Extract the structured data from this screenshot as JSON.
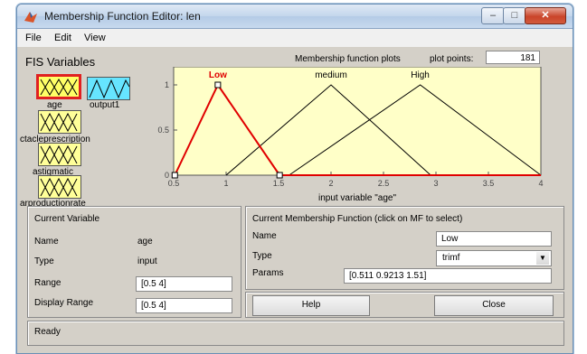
{
  "window": {
    "title": "Membership Function Editor: len",
    "min_icon": "minimize-icon",
    "max_icon": "maximize-icon",
    "close_icon": "close-icon"
  },
  "menu": {
    "items": [
      "File",
      "Edit",
      "View"
    ]
  },
  "fis_variables": {
    "title": "FIS Variables",
    "inputs": [
      "age",
      "ctacleprescription",
      "astigmatic",
      "arproductionrate"
    ],
    "outputs": [
      "output1"
    ],
    "selected": "age"
  },
  "plot": {
    "heading": "Membership function plots",
    "plot_points_label": "plot points:",
    "plot_points_value": "181",
    "xlabel": "input variable \"age\""
  },
  "chart_data": {
    "type": "line",
    "title": "",
    "xlabel": "input variable \"age\"",
    "ylabel": "",
    "xlim": [
      0.5,
      4
    ],
    "ylim": [
      0,
      1
    ],
    "x_ticks": [
      "0.5",
      "1",
      "1.5",
      "2",
      "2.5",
      "3",
      "3.5",
      "4"
    ],
    "y_ticks": [
      "0",
      "0.5",
      "1"
    ],
    "series": [
      {
        "name": "Low",
        "x": [
          0.511,
          0.9213,
          1.51
        ],
        "y": [
          0,
          1,
          0
        ],
        "color": "#e00000",
        "selected": true
      },
      {
        "name": "medium",
        "x": [
          1.0,
          2.0,
          2.95
        ],
        "y": [
          0,
          1,
          0
        ],
        "color": "#000000"
      },
      {
        "name": "High",
        "x": [
          1.6,
          2.85,
          4.0
        ],
        "y": [
          0,
          1,
          0
        ],
        "color": "#000000"
      }
    ]
  },
  "current_variable": {
    "title": "Current Variable",
    "name_label": "Name",
    "name_value": "age",
    "type_label": "Type",
    "type_value": "input",
    "range_label": "Range",
    "range_value": "[0.5 4]",
    "display_range_label": "Display Range",
    "display_range_value": "[0.5 4]"
  },
  "current_mf": {
    "title": "Current Membership Function (click on MF to select)",
    "name_label": "Name",
    "name_value": "Low",
    "type_label": "Type",
    "type_value": "trimf",
    "params_label": "Params",
    "params_value": "[0.511 0.9213 1.51]"
  },
  "buttons": {
    "help": "Help",
    "close": "Close"
  },
  "status": {
    "text": "Ready"
  },
  "colors": {
    "plot_bg": "#ffffc8",
    "selected_mf": "#e00000",
    "input_box": "#ffff99",
    "output_box": "#66e5ff"
  }
}
